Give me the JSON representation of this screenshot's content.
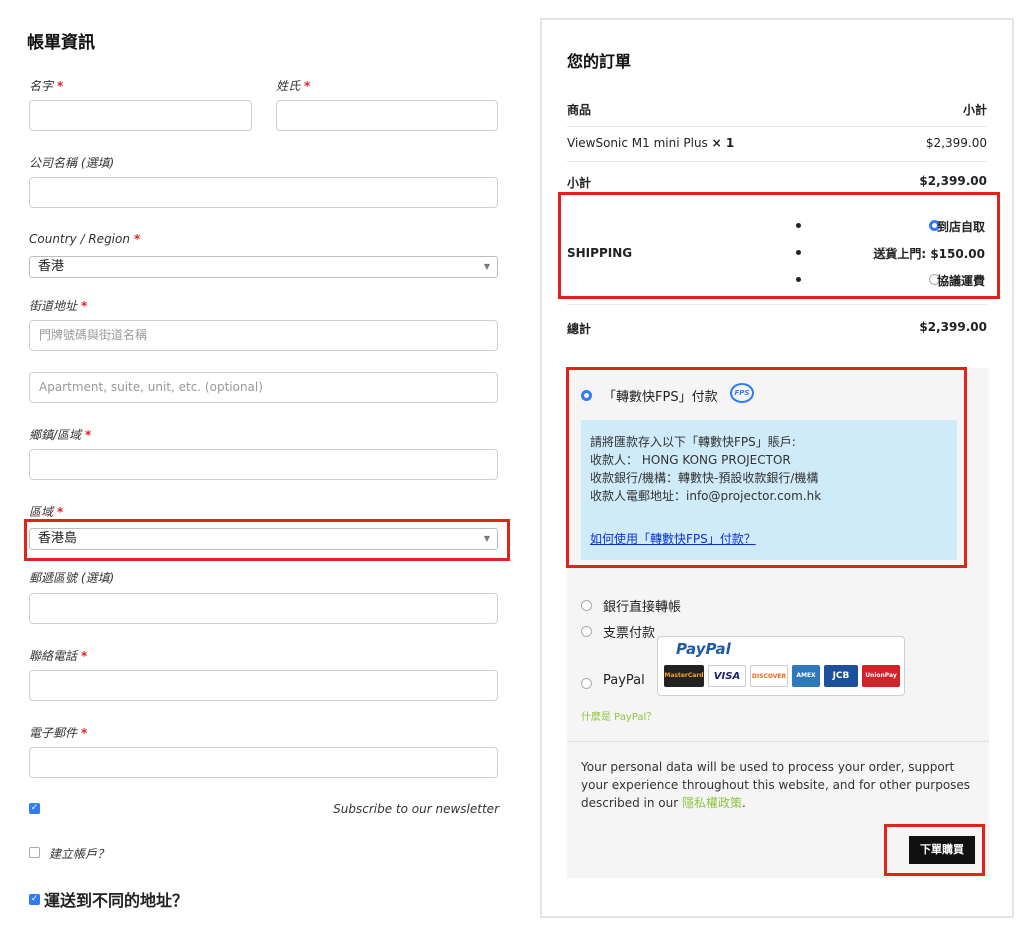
{
  "billing": {
    "title": "帳單資訊",
    "first_name_label": "名字",
    "last_name_label": "姓氏",
    "company_label": "公司名稱 (選填)",
    "country_label": "Country / Region",
    "country_value": "香港",
    "street_label": "街道地址",
    "street_placeholder": "門牌號碼與街道名稱",
    "apartment_placeholder": "Apartment, suite, unit, etc. (optional)",
    "town_label": "鄉鎮/區域",
    "region_label": "區域",
    "region_value": "香港島",
    "postcode_label": "郵遞區號 (選填)",
    "phone_label": "聯絡電話",
    "email_label": "電子郵件",
    "newsletter_label": "Subscribe to our newsletter",
    "create_account_label": "建立帳戶？",
    "ship_different_label": "運送到不同的地址？",
    "required_mark": "*"
  },
  "order": {
    "title": "您的訂單",
    "col_product": "商品",
    "col_subtotal": "小計",
    "item_name": "ViewSonic M1 mini Plus",
    "item_qty": "× 1",
    "item_price": "$2,399.00",
    "subtotal_label": "小計",
    "subtotal_value": "$2,399.00",
    "shipping_label": "SHIPPING",
    "shipping_options": [
      "到店自取",
      "送貨上門: $150.00",
      "協議運費"
    ],
    "total_label": "總計",
    "total_value": "$2,399.00"
  },
  "payment": {
    "fps_label": "「轉數快FPS」付款",
    "fps_icon": "FPS",
    "fps_lines": [
      "請將匯款存入以下「轉數快FPS」賬戶:",
      "收款人： HONG KONG PROJECTOR",
      "收款銀行/機構：轉數快-預設收款銀行/機構",
      "收款人電郵地址：info@projector.com.hk"
    ],
    "fps_link": "如何使用「轉數快FPS」付款？",
    "bank_label": "銀行直接轉帳",
    "cheque_label": "支票付款",
    "paypal_label": "PayPal",
    "paypal_logo_title": "PayPal",
    "cards": [
      "MasterCard",
      "VISA",
      "DISCOVER",
      "AMEX",
      "JCB",
      "UnionPay"
    ],
    "what_is_paypal": "什麼是 PayPal？",
    "privacy_text": "Your personal data will be used to process your order, support your experience throughout this website, and for other purposes described in our ",
    "privacy_link": "隱私權政策",
    "privacy_end": ".",
    "place_order": "下單購買"
  },
  "colors": {
    "accent": "#2f7cf6",
    "highlight": "#e2231a",
    "fps_bg": "#cfeaf8",
    "link_green": "#8dc63f"
  }
}
